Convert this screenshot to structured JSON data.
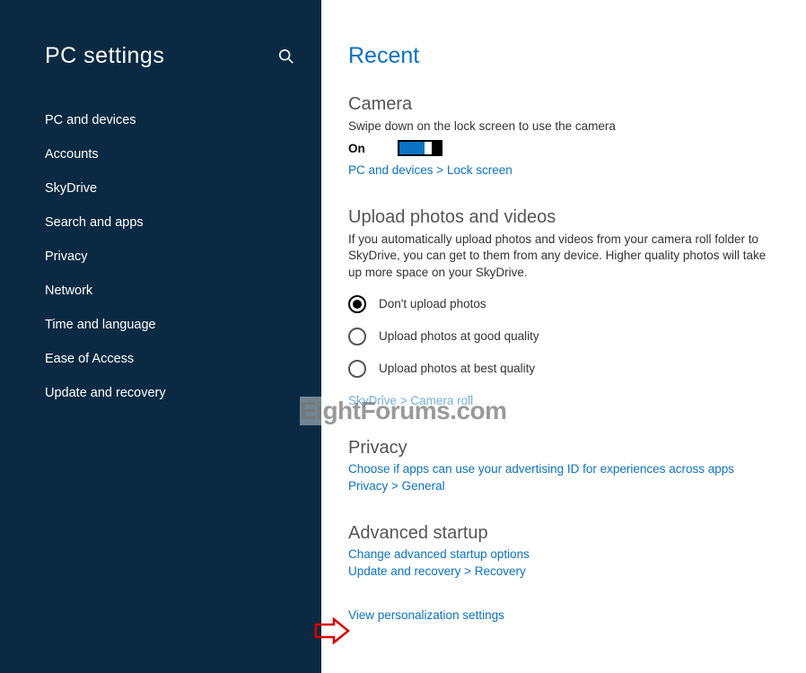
{
  "sidebar": {
    "title": "PC settings",
    "items": [
      "PC and devices",
      "Accounts",
      "SkyDrive",
      "Search and apps",
      "Privacy",
      "Network",
      "Time and language",
      "Ease of Access",
      "Update and recovery"
    ]
  },
  "content": {
    "title": "Recent",
    "camera": {
      "heading": "Camera",
      "desc": "Swipe down on the lock screen to use the camera",
      "toggle_state": "On",
      "link": "PC and devices > Lock screen"
    },
    "upload": {
      "heading": "Upload photos and videos",
      "desc": "If you automatically upload photos and videos from your camera roll folder to SkyDrive, you can get to them from any device. Higher quality photos will take up more space on your SkyDrive.",
      "options": [
        "Don't upload photos",
        "Upload photos at good quality",
        "Upload photos at best quality"
      ],
      "selected": 0,
      "link": "SkyDrive > Camera roll"
    },
    "privacy": {
      "heading": "Privacy",
      "link1": "Choose if apps can use your advertising ID for experiences across apps",
      "link2": "Privacy > General"
    },
    "startup": {
      "heading": "Advanced startup",
      "link1": "Change advanced startup options",
      "link2": "Update and recovery > Recovery"
    },
    "bottom_link": "View personalization settings"
  },
  "watermark": "EightForums.com"
}
